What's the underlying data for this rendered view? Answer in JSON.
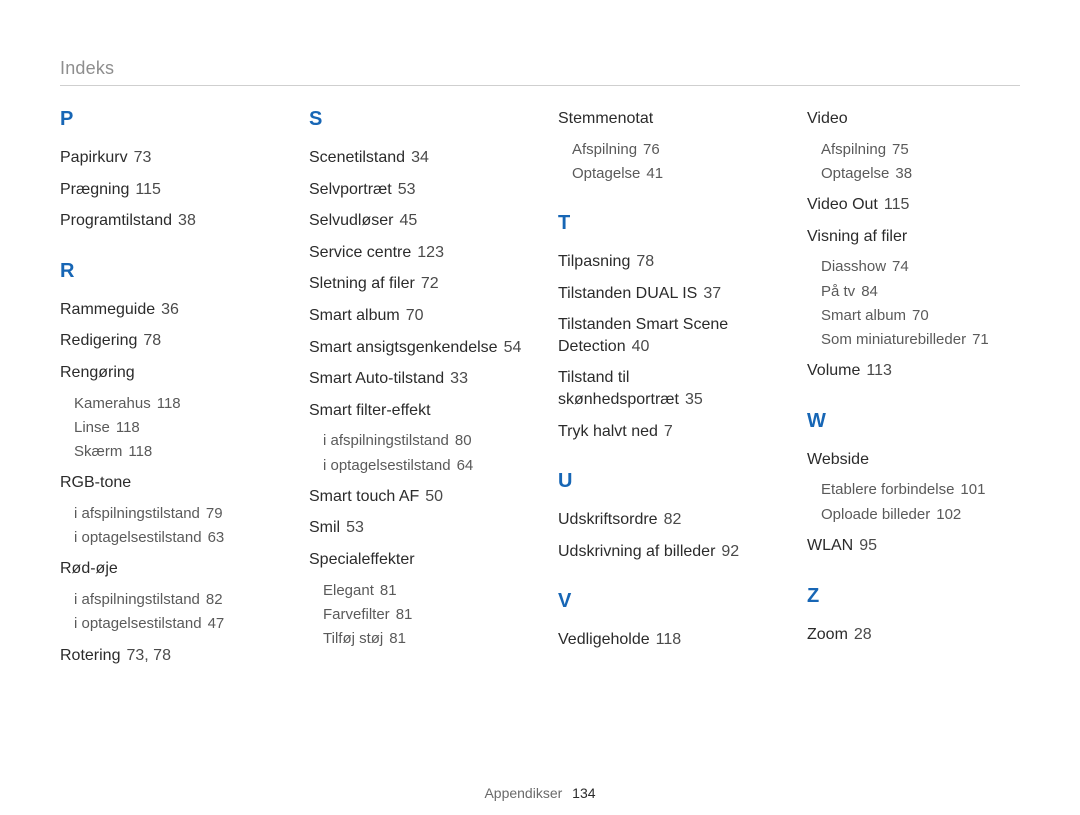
{
  "header": {
    "title": "Indeks"
  },
  "footer": {
    "section": "Appendikser",
    "page": "134"
  },
  "columns": [
    {
      "blocks": [
        {
          "letter": "P",
          "entries": [
            {
              "term": "Papirkurv",
              "pages": "73"
            },
            {
              "term": "Prægning",
              "pages": "115"
            },
            {
              "term": "Programtilstand",
              "pages": "38"
            }
          ]
        },
        {
          "letter": "R",
          "entries": [
            {
              "term": "Rammeguide",
              "pages": "36"
            },
            {
              "term": "Redigering",
              "pages": "78"
            },
            {
              "term": "Rengøring",
              "pages": "",
              "subs": [
                {
                  "term": "Kamerahus",
                  "pages": "118"
                },
                {
                  "term": "Linse",
                  "pages": "118"
                },
                {
                  "term": "Skærm",
                  "pages": "118"
                }
              ]
            },
            {
              "term": "RGB-tone",
              "pages": "",
              "subs": [
                {
                  "term": "i afspilningstilstand",
                  "pages": "79"
                },
                {
                  "term": "i optagelsestilstand",
                  "pages": "63"
                }
              ]
            },
            {
              "term": "Rød-øje",
              "pages": "",
              "subs": [
                {
                  "term": "i afspilningstilstand",
                  "pages": "82"
                },
                {
                  "term": "i optagelsestilstand",
                  "pages": "47"
                }
              ]
            },
            {
              "term": "Rotering",
              "pages": "73, 78"
            }
          ]
        }
      ]
    },
    {
      "blocks": [
        {
          "letter": "S",
          "entries": [
            {
              "term": "Scenetilstand",
              "pages": "34"
            },
            {
              "term": "Selvportræt",
              "pages": "53"
            },
            {
              "term": "Selvudløser",
              "pages": "45"
            },
            {
              "term": "Service centre",
              "pages": "123"
            },
            {
              "term": "Sletning af filer",
              "pages": "72"
            },
            {
              "term": "Smart album",
              "pages": "70"
            },
            {
              "term": "Smart ansigtsgenkendelse",
              "pages": "54"
            },
            {
              "term": "Smart Auto-tilstand",
              "pages": "33"
            },
            {
              "term": "Smart filter-effekt",
              "pages": "",
              "subs": [
                {
                  "term": "i afspilningstilstand",
                  "pages": "80"
                },
                {
                  "term": "i optagelsestilstand",
                  "pages": "64"
                }
              ]
            },
            {
              "term": "Smart touch AF",
              "pages": "50"
            },
            {
              "term": "Smil",
              "pages": "53"
            },
            {
              "term": "Specialeffekter",
              "pages": "",
              "subs": [
                {
                  "term": "Elegant",
                  "pages": "81"
                },
                {
                  "term": "Farvefilter",
                  "pages": "81"
                },
                {
                  "term": "Tilføj støj",
                  "pages": "81"
                }
              ]
            }
          ]
        }
      ]
    },
    {
      "blocks": [
        {
          "letter": "",
          "entries": [
            {
              "term": "Stemmenotat",
              "pages": "",
              "subs": [
                {
                  "term": "Afspilning",
                  "pages": "76"
                },
                {
                  "term": "Optagelse",
                  "pages": "41"
                }
              ]
            }
          ]
        },
        {
          "letter": "T",
          "entries": [
            {
              "term": "Tilpasning",
              "pages": "78"
            },
            {
              "term": "Tilstanden DUAL IS",
              "pages": "37"
            },
            {
              "term": "Tilstanden Smart Scene Detection",
              "pages": "40"
            },
            {
              "term": "Tilstand til skønhedsportræt",
              "pages": "35"
            },
            {
              "term": "Tryk halvt ned",
              "pages": "7"
            }
          ]
        },
        {
          "letter": "U",
          "entries": [
            {
              "term": "Udskriftsordre",
              "pages": "82"
            },
            {
              "term": "Udskrivning af billeder",
              "pages": "92"
            }
          ]
        },
        {
          "letter": "V",
          "entries": [
            {
              "term": "Vedligeholde",
              "pages": "118"
            }
          ]
        }
      ]
    },
    {
      "blocks": [
        {
          "letter": "",
          "entries": [
            {
              "term": "Video",
              "pages": "",
              "subs": [
                {
                  "term": "Afspilning",
                  "pages": "75"
                },
                {
                  "term": "Optagelse",
                  "pages": "38"
                }
              ]
            },
            {
              "term": "Video Out",
              "pages": "115"
            },
            {
              "term": "Visning af filer",
              "pages": "",
              "subs": [
                {
                  "term": "Diasshow",
                  "pages": "74"
                },
                {
                  "term": "På tv",
                  "pages": "84"
                },
                {
                  "term": "Smart album",
                  "pages": "70"
                },
                {
                  "term": "Som miniaturebilleder",
                  "pages": "71"
                }
              ]
            },
            {
              "term": "Volume",
              "pages": "113"
            }
          ]
        },
        {
          "letter": "W",
          "entries": [
            {
              "term": "Webside",
              "pages": "",
              "subs": [
                {
                  "term": "Etablere forbindelse",
                  "pages": "101"
                },
                {
                  "term": "Oploade billeder",
                  "pages": "102"
                }
              ]
            },
            {
              "term": "WLAN",
              "pages": "95"
            }
          ]
        },
        {
          "letter": "Z",
          "entries": [
            {
              "term": "Zoom",
              "pages": "28"
            }
          ]
        }
      ]
    }
  ]
}
